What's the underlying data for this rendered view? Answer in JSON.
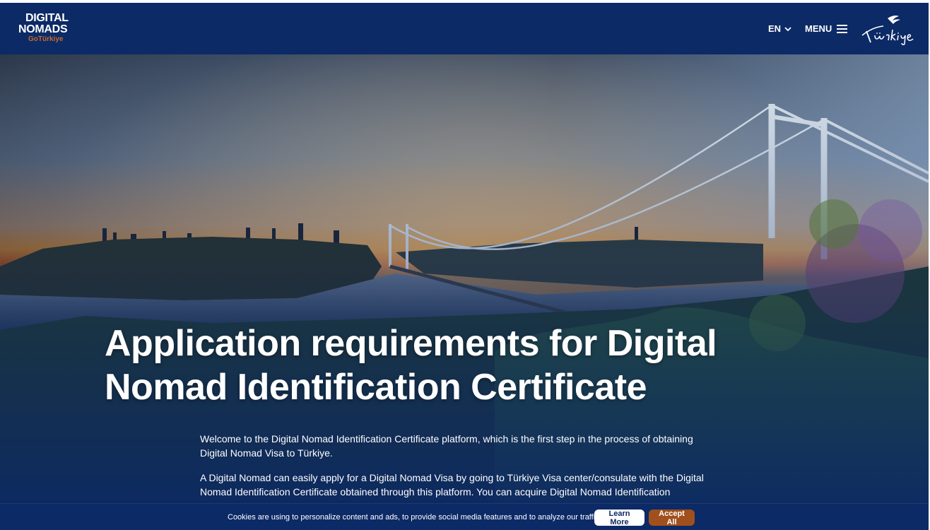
{
  "header": {
    "logo_line1": "DIGITAL",
    "logo_line2": "NOMADS",
    "logo_line3": "GoTürkiye",
    "language": "EN",
    "menu_label": "MENU",
    "brand_wordmark": "Türkiye"
  },
  "hero": {
    "title": "Application requirements for Digital Nomad Identification Certificate",
    "paragraph1": "Welcome to the Digital Nomad Identification Certificate platform, which is the first step in the process of obtaining Digital Nomad Visa to Türkiye.",
    "paragraph2": "A Digital Nomad can easily apply for a Digital Nomad Visa by going to Türkiye Visa center/consulate with the Digital Nomad Identification Certificate obtained through this platform. You can acquire Digital Nomad Identification"
  },
  "cookie": {
    "text": "Cookies are using to personalize content and ads, to provide social media features and to analyze our traffic.",
    "learn_more": "Learn More",
    "accept_all": "Accept All"
  },
  "colors": {
    "header_bg": "#0c2a66",
    "accent_orange": "#a0501c",
    "logo_orange": "#c36b2c"
  },
  "icons": {
    "language_dropdown": "chevron-down-icon",
    "menu": "hamburger-icon",
    "brand": "turkiye-bird-logo"
  }
}
